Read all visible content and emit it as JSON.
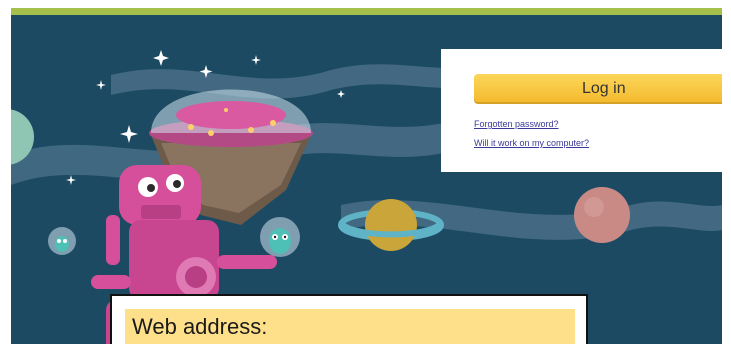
{
  "login": {
    "button_label": "Log in",
    "forgotten_password_link": "Forgotten password?",
    "compatibility_link": "Will it work on my computer?"
  },
  "callout": {
    "label": "Web address:"
  },
  "colors": {
    "top_bar": "#a4c04a",
    "sky": "#1d4a63",
    "login_button": "#f7c63e",
    "link": "#3a3a9a",
    "callout_field": "#ffe08a",
    "robot": "#d64f9a"
  },
  "icons": {
    "hero": "robot-illustration",
    "planets": "planet-icon",
    "aliens": "alien-icon",
    "stars": "sparkle-icon"
  }
}
